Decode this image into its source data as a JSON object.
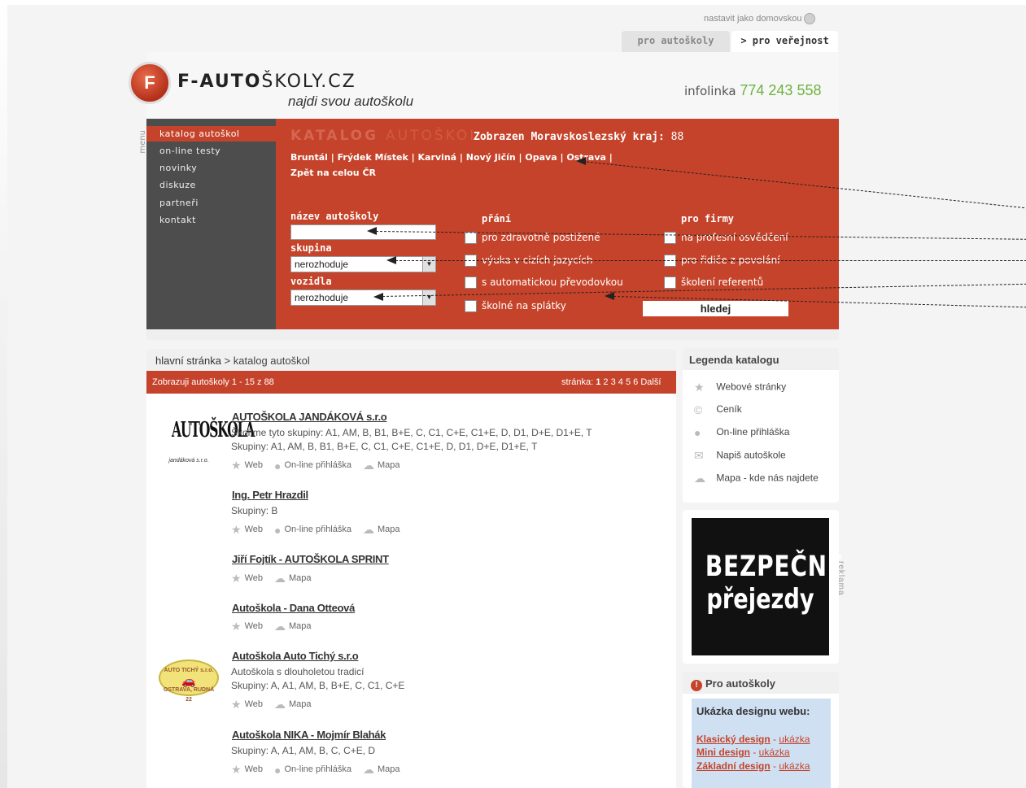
{
  "top": {
    "homepage_link": "nastavit jako domovskou",
    "tab_autoskoly": "pro autoškoly",
    "tab_verejnost": "> pro veřejnost"
  },
  "header": {
    "logo_bold": "F-AUTO",
    "logo_rest": "ŠKOLY.CZ",
    "tagline": "najdi svou autoškolu",
    "infolinka_label": "infolinka",
    "infolinka_number": "774 243 558"
  },
  "menu": {
    "vertical_label": "menu",
    "items": [
      "katalog autoškol",
      "on-line testy",
      "novinky",
      "diskuze",
      "partneři",
      "kontakt"
    ]
  },
  "search": {
    "title_bold": "KATALOG",
    "title_light": "AUTOŠKOL",
    "region_label": "Zobrazen Moravskoslezský kraj:",
    "region_count": "88",
    "towns": [
      "Bruntál",
      "Frýdek Místek",
      "Karviná",
      "Nový Jičín",
      "Opava",
      "Ostrava"
    ],
    "back_link": "Zpět na celou ČR",
    "name_label": "název autoškoly",
    "name_value": "",
    "group_label": "skupina",
    "group_value": "nerozhoduje",
    "vehicle_label": "vozidla",
    "vehicle_value": "nerozhoduje",
    "wishes_label": "přání",
    "wishes": [
      "pro zdravotně postižené",
      "výuka v cizích jazycích",
      "s automatickou převodovkou",
      "školné na splátky"
    ],
    "firms_label": "pro firmy",
    "firms": [
      "na profesní osvědčení",
      "pro řidiče z povolání",
      "školení referentů"
    ],
    "submit": "hledej"
  },
  "listing": {
    "breadcrumb_home": "hlavní stránka",
    "breadcrumb_sep": " > ",
    "breadcrumb_current": "katalog autoškol",
    "count_text": "Zobrazuji autoškoly 1 - 15 z 88",
    "pager_label": "stránka:",
    "pages": [
      "1",
      "2",
      "3",
      "4",
      "5",
      "6"
    ],
    "next": "Další",
    "link_web": "Web",
    "link_online": "On-line přihláška",
    "link_map": "Mapa",
    "schools": [
      {
        "name": "AUTOŠKOLA JANDÁKOVÁ s.r.o",
        "line1": "Školíme tyto skupiny: A1, AM, B, B1, B+E, C, C1, C+E, C1+E, D, D1, D+E, D1+E, T",
        "line2": "Skupiny: A1, AM, B, B1, B+E, C, C1, C+E, C1+E, D, D1, D+E, D1+E, T"
      },
      {
        "name": "Ing. Petr Hrazdil",
        "line1": "Skupiny: B"
      },
      {
        "name": "Jiří Fojtík - AUTOŠKOLA SPRINT"
      },
      {
        "name": "Autoškola - Dana Otteová"
      },
      {
        "name": "Autoškola Auto Tichý s.r.o",
        "line1": "Autoškola s dlouholetou tradicí",
        "line2": "Skupiny: A, A1, AM, B, B+E, C, C1, C+E"
      },
      {
        "name": "Autoškola NIKA - Mojmír Blahák",
        "line1": "Skupiny: A, A1, AM, B, C, C+E, D"
      }
    ],
    "logo1_big": "AUTOŠKOLA",
    "logo1_small": "jandáková s.r.o.",
    "logo2_top": "AUTO TICHÝ s.r.o.",
    "logo2_bottom": "OSTRAVA, RUDNÁ 22"
  },
  "legend": {
    "title": "Legenda katalogu",
    "items": [
      "Webové stránky",
      "Ceník",
      "On-line přihláška",
      "Napiš autoškole",
      "Mapa - kde nás najdete"
    ]
  },
  "ad": {
    "line1": "BEZPEČNÉ",
    "line2": "přejezdy",
    "side_label": "reklama"
  },
  "pro": {
    "title": "Pro autoškoly",
    "subtitle": "Ukázka designu webu:",
    "links": [
      {
        "name": "Klasický design",
        "suffix": "ukázka"
      },
      {
        "name": "Mini design",
        "suffix": "ukázka"
      },
      {
        "name": "Základní design",
        "suffix": "ukázka"
      }
    ]
  }
}
